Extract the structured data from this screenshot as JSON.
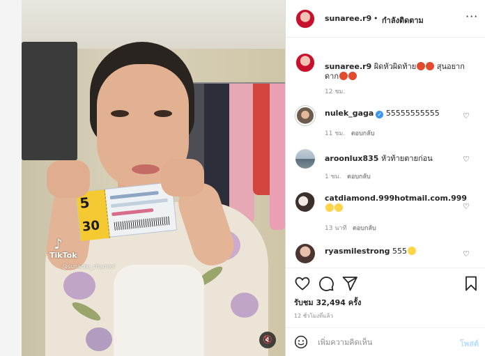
{
  "video": {
    "tiktok_label": "TikTok",
    "tiktok_logo": "♪",
    "tiktok_handle": "@sunaree_channel",
    "ticket_top_number": "5",
    "ticket_bottom_number": "30",
    "mute_icon": "🔇"
  },
  "header": {
    "username": "sunaree.r9",
    "separator": "•",
    "follow_status": "กำลังติดตาม",
    "more": "···"
  },
  "caption": {
    "username": "sunaree.r9",
    "text_line1": "ผิดหัวผิดท้าย",
    "text_line1_tail": "สุนอยาก",
    "text_line2": "ดาก",
    "time": "12 ชม."
  },
  "comments": [
    {
      "username": "nulek_gaga",
      "verified": true,
      "text": "55555555555",
      "time": "11 ชม.",
      "reply": "ตอบกลับ"
    },
    {
      "username": "aroonlux835",
      "verified": false,
      "text": "หัวท้ายตายก่อน",
      "time": "1 ชม.",
      "reply": "ตอบกลับ"
    },
    {
      "username": "catdiamond.999hotmail.com.999",
      "verified": false,
      "text": "",
      "time": "13 นาที",
      "reply": "ตอบกลับ"
    },
    {
      "username": "ryasmilestrong",
      "verified": false,
      "text": "555",
      "time": "",
      "reply": ""
    }
  ],
  "actions": {
    "likes_prefix": "รับชม",
    "likes_count": "32,494",
    "likes_suffix": "ครั้ง",
    "time_ago": "12 ชั่วโมงที่แล้ว"
  },
  "composer": {
    "placeholder": "เพิ่มความคิดเห็น",
    "post_label": "โพสต์"
  },
  "colors": {
    "link_blue": "#3897f0",
    "post_disabled": "#b2dffc",
    "meta_gray": "#8e8e8e"
  }
}
